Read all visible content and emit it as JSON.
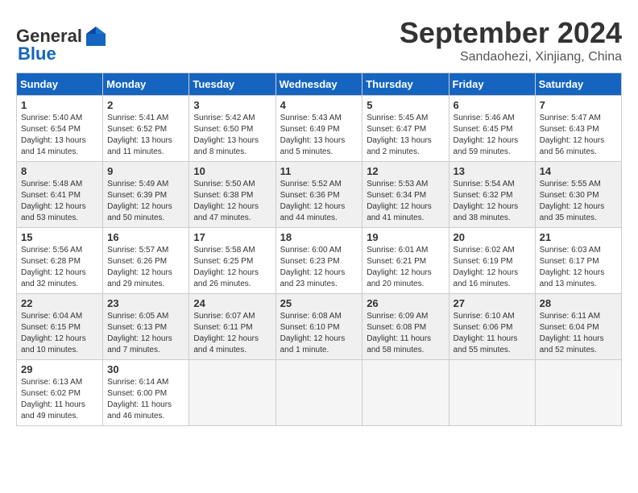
{
  "header": {
    "logo_line1": "General",
    "logo_line2": "Blue",
    "month": "September 2024",
    "location": "Sandaohezi, Xinjiang, China"
  },
  "weekdays": [
    "Sunday",
    "Monday",
    "Tuesday",
    "Wednesday",
    "Thursday",
    "Friday",
    "Saturday"
  ],
  "weeks": [
    {
      "shaded": false,
      "days": [
        {
          "num": "1",
          "info": "Sunrise: 5:40 AM\nSunset: 6:54 PM\nDaylight: 13 hours\nand 14 minutes."
        },
        {
          "num": "2",
          "info": "Sunrise: 5:41 AM\nSunset: 6:52 PM\nDaylight: 13 hours\nand 11 minutes."
        },
        {
          "num": "3",
          "info": "Sunrise: 5:42 AM\nSunset: 6:50 PM\nDaylight: 13 hours\nand 8 minutes."
        },
        {
          "num": "4",
          "info": "Sunrise: 5:43 AM\nSunset: 6:49 PM\nDaylight: 13 hours\nand 5 minutes."
        },
        {
          "num": "5",
          "info": "Sunrise: 5:45 AM\nSunset: 6:47 PM\nDaylight: 13 hours\nand 2 minutes."
        },
        {
          "num": "6",
          "info": "Sunrise: 5:46 AM\nSunset: 6:45 PM\nDaylight: 12 hours\nand 59 minutes."
        },
        {
          "num": "7",
          "info": "Sunrise: 5:47 AM\nSunset: 6:43 PM\nDaylight: 12 hours\nand 56 minutes."
        }
      ]
    },
    {
      "shaded": true,
      "days": [
        {
          "num": "8",
          "info": "Sunrise: 5:48 AM\nSunset: 6:41 PM\nDaylight: 12 hours\nand 53 minutes."
        },
        {
          "num": "9",
          "info": "Sunrise: 5:49 AM\nSunset: 6:39 PM\nDaylight: 12 hours\nand 50 minutes."
        },
        {
          "num": "10",
          "info": "Sunrise: 5:50 AM\nSunset: 6:38 PM\nDaylight: 12 hours\nand 47 minutes."
        },
        {
          "num": "11",
          "info": "Sunrise: 5:52 AM\nSunset: 6:36 PM\nDaylight: 12 hours\nand 44 minutes."
        },
        {
          "num": "12",
          "info": "Sunrise: 5:53 AM\nSunset: 6:34 PM\nDaylight: 12 hours\nand 41 minutes."
        },
        {
          "num": "13",
          "info": "Sunrise: 5:54 AM\nSunset: 6:32 PM\nDaylight: 12 hours\nand 38 minutes."
        },
        {
          "num": "14",
          "info": "Sunrise: 5:55 AM\nSunset: 6:30 PM\nDaylight: 12 hours\nand 35 minutes."
        }
      ]
    },
    {
      "shaded": false,
      "days": [
        {
          "num": "15",
          "info": "Sunrise: 5:56 AM\nSunset: 6:28 PM\nDaylight: 12 hours\nand 32 minutes."
        },
        {
          "num": "16",
          "info": "Sunrise: 5:57 AM\nSunset: 6:26 PM\nDaylight: 12 hours\nand 29 minutes."
        },
        {
          "num": "17",
          "info": "Sunrise: 5:58 AM\nSunset: 6:25 PM\nDaylight: 12 hours\nand 26 minutes."
        },
        {
          "num": "18",
          "info": "Sunrise: 6:00 AM\nSunset: 6:23 PM\nDaylight: 12 hours\nand 23 minutes."
        },
        {
          "num": "19",
          "info": "Sunrise: 6:01 AM\nSunset: 6:21 PM\nDaylight: 12 hours\nand 20 minutes."
        },
        {
          "num": "20",
          "info": "Sunrise: 6:02 AM\nSunset: 6:19 PM\nDaylight: 12 hours\nand 16 minutes."
        },
        {
          "num": "21",
          "info": "Sunrise: 6:03 AM\nSunset: 6:17 PM\nDaylight: 12 hours\nand 13 minutes."
        }
      ]
    },
    {
      "shaded": true,
      "days": [
        {
          "num": "22",
          "info": "Sunrise: 6:04 AM\nSunset: 6:15 PM\nDaylight: 12 hours\nand 10 minutes."
        },
        {
          "num": "23",
          "info": "Sunrise: 6:05 AM\nSunset: 6:13 PM\nDaylight: 12 hours\nand 7 minutes."
        },
        {
          "num": "24",
          "info": "Sunrise: 6:07 AM\nSunset: 6:11 PM\nDaylight: 12 hours\nand 4 minutes."
        },
        {
          "num": "25",
          "info": "Sunrise: 6:08 AM\nSunset: 6:10 PM\nDaylight: 12 hours\nand 1 minute."
        },
        {
          "num": "26",
          "info": "Sunrise: 6:09 AM\nSunset: 6:08 PM\nDaylight: 11 hours\nand 58 minutes."
        },
        {
          "num": "27",
          "info": "Sunrise: 6:10 AM\nSunset: 6:06 PM\nDaylight: 11 hours\nand 55 minutes."
        },
        {
          "num": "28",
          "info": "Sunrise: 6:11 AM\nSunset: 6:04 PM\nDaylight: 11 hours\nand 52 minutes."
        }
      ]
    },
    {
      "shaded": false,
      "days": [
        {
          "num": "29",
          "info": "Sunrise: 6:13 AM\nSunset: 6:02 PM\nDaylight: 11 hours\nand 49 minutes."
        },
        {
          "num": "30",
          "info": "Sunrise: 6:14 AM\nSunset: 6:00 PM\nDaylight: 11 hours\nand 46 minutes."
        },
        {
          "num": "",
          "info": ""
        },
        {
          "num": "",
          "info": ""
        },
        {
          "num": "",
          "info": ""
        },
        {
          "num": "",
          "info": ""
        },
        {
          "num": "",
          "info": ""
        }
      ]
    }
  ]
}
